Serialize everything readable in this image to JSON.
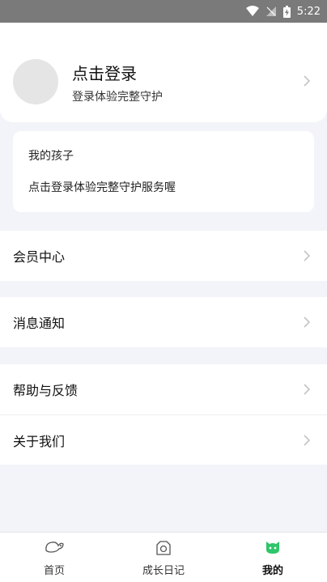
{
  "status_bar": {
    "time": "5:22"
  },
  "profile": {
    "title": "点击登录",
    "subtitle": "登录体验完整守护"
  },
  "kids": {
    "title": "我的孩子",
    "description": "点击登录体验完整守护服务喔"
  },
  "menu": {
    "member_center": "会员中心",
    "notifications": "消息通知",
    "help_feedback": "帮助与反馈",
    "about_us": "关于我们"
  },
  "tabs": [
    {
      "label": "首页",
      "icon": "home-icon"
    },
    {
      "label": "成长日记",
      "icon": "camera-icon"
    },
    {
      "label": "我的",
      "icon": "mine-avatar-icon",
      "active": true
    }
  ],
  "colors": {
    "accent_green": "#2fc56a",
    "background": "#f2f4f9"
  }
}
